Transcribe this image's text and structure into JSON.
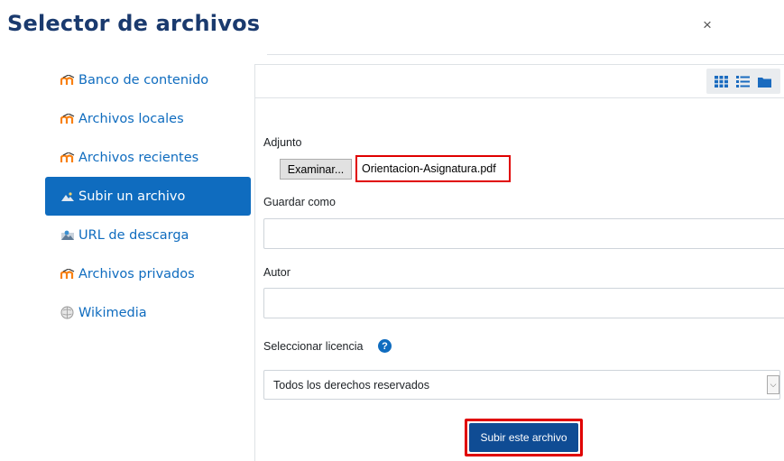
{
  "dialog": {
    "title": "Selector de archivos",
    "close_glyph": "×"
  },
  "sidebar": {
    "items": [
      {
        "label": "Banco de contenido",
        "icon": "moodle-icon"
      },
      {
        "label": "Archivos locales",
        "icon": "moodle-icon"
      },
      {
        "label": "Archivos recientes",
        "icon": "moodle-icon"
      },
      {
        "label": "Subir un archivo",
        "icon": "upload-icon",
        "active": true
      },
      {
        "label": "URL de descarga",
        "icon": "download-url-icon"
      },
      {
        "label": "Archivos privados",
        "icon": "moodle-icon"
      },
      {
        "label": "Wikimedia",
        "icon": "wikimedia-icon"
      }
    ]
  },
  "toolbar": {
    "views": [
      "grid-view-icon",
      "list-view-icon",
      "folder-view-icon"
    ]
  },
  "form": {
    "attachment_label": "Adjunto",
    "browse_label": "Examinar...",
    "file_name": "Orientacion-Asignatura.pdf",
    "save_as_label": "Guardar como",
    "save_as_value": "",
    "author_label": "Autor",
    "author_value": "",
    "license_label": "Seleccionar licencia",
    "license_value": "Todos los derechos reservados",
    "submit_label": "Subir este archivo"
  },
  "colors": {
    "accent": "#0f6cbf",
    "title": "#1a3a6e",
    "highlight": "#e00000"
  }
}
